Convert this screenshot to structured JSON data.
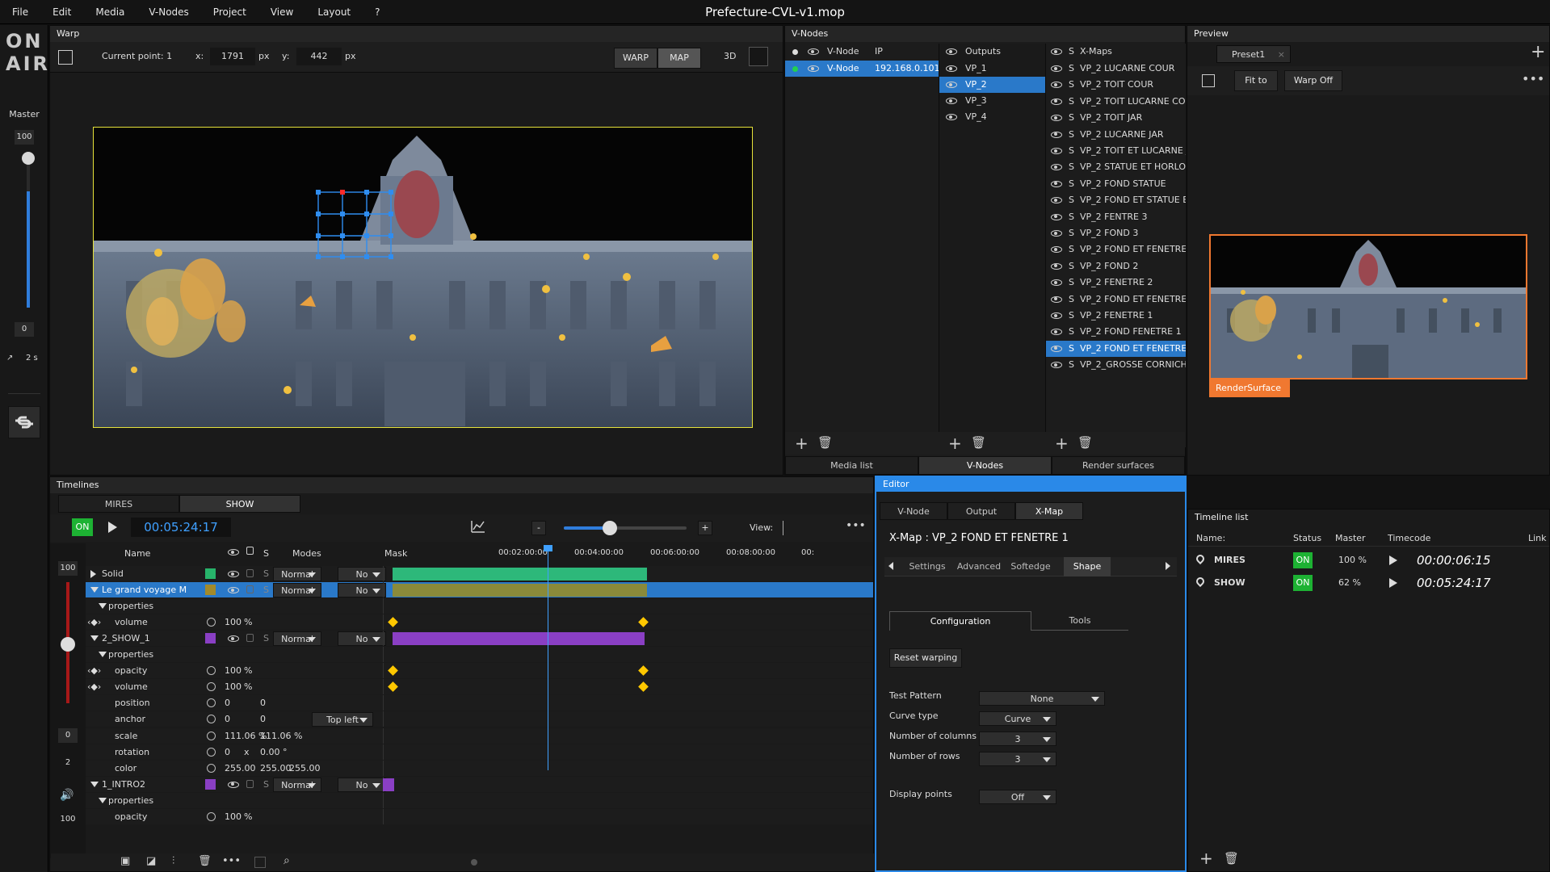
{
  "app": {
    "title": "Prefecture-CVL-v1.mop",
    "menu": [
      "File",
      "Edit",
      "Media",
      "V-Nodes",
      "Project",
      "View",
      "Layout",
      "?"
    ],
    "logo_top": "ON",
    "logo_bottom": "AIR"
  },
  "master": {
    "label": "Master",
    "top_value": "100",
    "bottom_value": "0",
    "duration": "2 s",
    "level": 0.78
  },
  "warp": {
    "title": "Warp",
    "current_point_label": "Current point: 1",
    "x_label": "x:",
    "x_value": "1791",
    "y_label": "y:",
    "y_value": "442",
    "unit": "px",
    "btn_warp": "WARP",
    "btn_map": "MAP",
    "btn_3d": "3D"
  },
  "vnodes": {
    "title": "V-Nodes",
    "col_vnode": "V-Node",
    "col_ip": "IP",
    "node_name": "V-Node",
    "node_ip": "192.168.0.101",
    "col_outputs": "Outputs",
    "outputs": [
      "VP_1",
      "VP_2",
      "VP_3",
      "VP_4"
    ],
    "selected_output": 1,
    "col_s": "S",
    "col_xmaps": "X-Maps",
    "xmaps": [
      "VP_2 LUCARNE COUR",
      "VP_2 TOIT COUR",
      "VP_2 TOIT LUCARNE COUR",
      "VP_2 TOIT JAR",
      "VP_2 LUCARNE JAR",
      "VP_2 TOIT ET LUCARNE JAR",
      "VP_2 STATUE ET HORLOGE",
      "VP_2 FOND STATUE",
      "VP_2 FOND ET STATUE ET",
      "VP_2 FENTRE 3",
      "VP_2 FOND 3",
      "VP_2 FOND ET FENETRE",
      "VP_2 FOND 2",
      "VP_2 FENETRE 2",
      "VP_2 FOND ET FENETRE",
      "VP_2 FENETRE 1",
      "VP_2 FOND FENETRE 1",
      "VP_2 FOND ET FENETRE",
      "VP_2_GROSSE CORNICHE"
    ],
    "selected_xmap": 17,
    "tabs": [
      "Media list",
      "V-Nodes",
      "Render surfaces"
    ],
    "active_tab": 1
  },
  "preview": {
    "title": "Preview",
    "preset": "Preset1",
    "fit_to": "Fit to",
    "warp_off": "Warp Off",
    "render_surface": "RenderSurface"
  },
  "timelines": {
    "title": "Timelines",
    "tabs": [
      "MIRES",
      "SHOW"
    ],
    "active_tab": 1,
    "on_label": "ON",
    "timecode": "00:05:24:17",
    "col_name": "Name",
    "col_s": "S",
    "col_modes": "Modes",
    "col_mask": "Mask",
    "view_label": "View:",
    "ruler": [
      "00:02:00:00",
      "00:04:00:00",
      "00:06:00:00",
      "00:08:00:00",
      "00:"
    ],
    "left_values": {
      "v100a": "100",
      "v0": "0",
      "v2": "2",
      "v100b": "100"
    },
    "layers": [
      {
        "name": "Solid",
        "indent": 0,
        "type": "layer",
        "arrow": "right",
        "color": "#27b36a",
        "mode": "Normal",
        "mask": "No"
      },
      {
        "name": "Le grand voyage M",
        "indent": 0,
        "type": "layer",
        "arrow": "down",
        "color": "#a38a2a",
        "mode": "Normal",
        "mask": "No",
        "selected": true
      },
      {
        "name": "properties",
        "indent": 1,
        "type": "group",
        "arrow": "down"
      },
      {
        "name": "volume",
        "indent": 2,
        "type": "prop",
        "nav": true,
        "v1": "100",
        "u1": "%"
      },
      {
        "name": "2_SHOW_1",
        "indent": 0,
        "type": "layer",
        "arrow": "down",
        "color": "#8a3fc4",
        "mode": "Normal",
        "mask": "No"
      },
      {
        "name": "properties",
        "indent": 1,
        "type": "group",
        "arrow": "down"
      },
      {
        "name": "opacity",
        "indent": 2,
        "type": "prop",
        "nav": true,
        "v1": "100",
        "u1": "%"
      },
      {
        "name": "volume",
        "indent": 2,
        "type": "prop",
        "nav": true,
        "v1": "100",
        "u1": "%"
      },
      {
        "name": "position",
        "indent": 2,
        "type": "prop",
        "v1": "0",
        "v2": "0"
      },
      {
        "name": "anchor",
        "indent": 2,
        "type": "prop",
        "v1": "0",
        "v2": "0",
        "dd": "Top left"
      },
      {
        "name": "scale",
        "indent": 2,
        "type": "prop",
        "v1": "111.06 %",
        "v2": "111.06 %"
      },
      {
        "name": "rotation",
        "indent": 2,
        "type": "prop",
        "v1": "0",
        "u1": "x",
        "v2": "0.00",
        "u2": "°"
      },
      {
        "name": "color",
        "indent": 2,
        "type": "prop",
        "v1": "255.00",
        "v2": "255.00",
        "v3": "255.00"
      },
      {
        "name": "1_INTRO2",
        "indent": 0,
        "type": "layer",
        "arrow": "down",
        "color": "#8a3fc4",
        "mode": "Normal",
        "mask": "No"
      },
      {
        "name": "properties",
        "indent": 1,
        "type": "group",
        "arrow": "down"
      },
      {
        "name": "opacity",
        "indent": 2,
        "type": "prop",
        "v1": "100",
        "u1": "%"
      }
    ]
  },
  "editor": {
    "title": "Editor",
    "tabs": [
      "V-Node",
      "Output",
      "X-Map"
    ],
    "active_tab": 2,
    "heading": "X-Map : VP_2 FOND ET FENETRE 1",
    "subtabs": [
      "Settings",
      "Advanced",
      "Softedge",
      "Shape"
    ],
    "active_subtab": 3,
    "config_tabs": [
      "Configuration",
      "Tools"
    ],
    "reset_warping": "Reset warping",
    "fields": [
      {
        "label": "Test Pattern",
        "value": "None"
      },
      {
        "label": "Curve type",
        "value": "Curve"
      },
      {
        "label": "Number of columns",
        "value": "3"
      },
      {
        "label": "Number of rows",
        "value": "3"
      },
      {
        "label": "Display points",
        "value": "Off"
      }
    ]
  },
  "timeline_list": {
    "title": "Timeline list",
    "col_name": "Name:",
    "col_status": "Status",
    "col_master": "Master",
    "col_timecode": "Timecode",
    "col_link": "Link",
    "rows": [
      {
        "name": "MIRES",
        "status": "ON",
        "master": "100 %",
        "timecode": "00:00:06:15"
      },
      {
        "name": "SHOW",
        "status": "ON",
        "master": "62 %",
        "timecode": "00:05:24:17"
      }
    ]
  }
}
